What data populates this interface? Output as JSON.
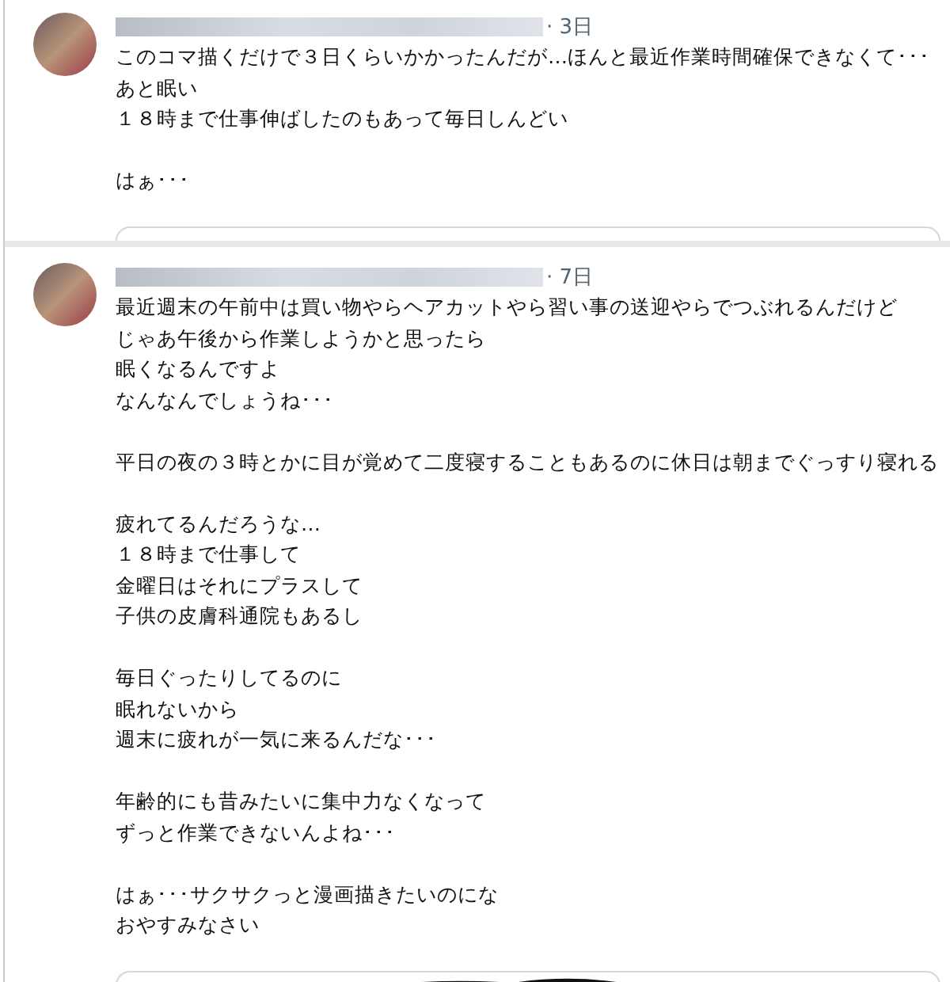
{
  "posts": [
    {
      "time": "· 3日",
      "paragraphs": [
        [
          "このコマ描くだけで３日くらいかかったんだが…ほんと最近作業時間確保できなくて･･･あと眠い",
          "１８時まで仕事伸ばしたのもあって毎日しんどい"
        ],
        [
          "はぁ･･･"
        ]
      ],
      "media": true
    },
    {
      "time": "· 7日",
      "paragraphs": [
        [
          "最近週末の午前中は買い物やらヘアカットやら習い事の送迎やらでつぶれるんだけど",
          "じゃあ午後から作業しようかと思ったら",
          "眠くなるんですよ",
          "なんなんでしょうね･･･"
        ],
        [
          "平日の夜の３時とかに目が覚めて二度寝することもあるのに休日は朝までぐっすり寝れる"
        ],
        [
          "疲れてるんだろうな…",
          "１８時まで仕事して",
          "金曜日はそれにプラスして",
          "子供の皮膚科通院もあるし"
        ],
        [
          "毎日ぐったりしてるのに",
          "眠れないから",
          "週末に疲れが一気に来るんだな･･･"
        ],
        [
          "年齢的にも昔みたいに集中力なくなって",
          "ずっと作業できないんよね･･･"
        ],
        [
          "はぁ･･･サクサクっと漫画描きたいのにな",
          "おやすみなさい"
        ]
      ],
      "media": true
    }
  ]
}
